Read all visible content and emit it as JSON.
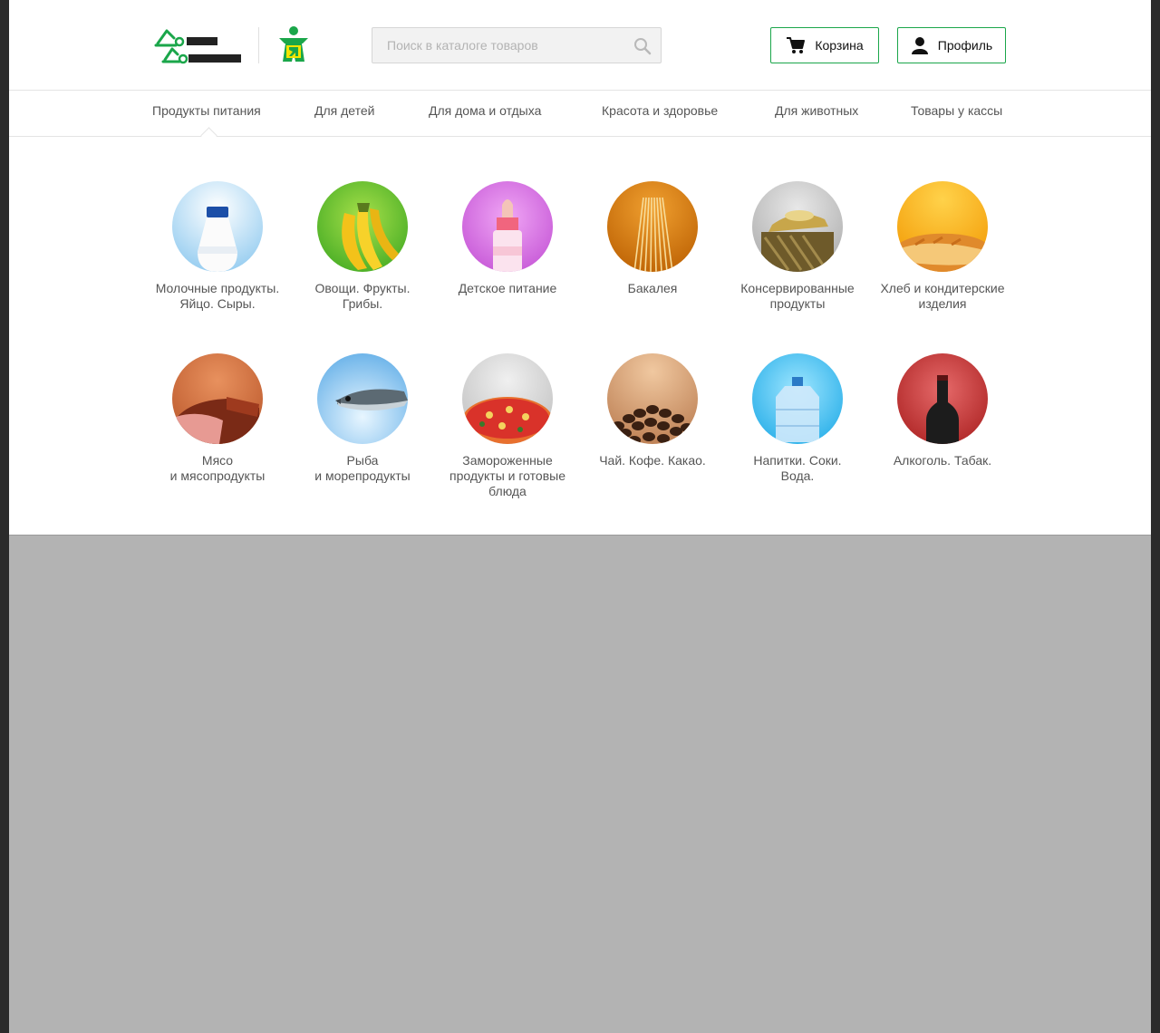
{
  "search": {
    "placeholder": "Поиск в каталоге товаров"
  },
  "header": {
    "cart_label": "Корзина",
    "profile_label": "Профиль"
  },
  "nav": {
    "items": [
      {
        "label": "Продукты питания"
      },
      {
        "label": "Для детей"
      },
      {
        "label": "Для дома и отдыха"
      },
      {
        "label": "Красота и здоровье"
      },
      {
        "label": "Для животных"
      },
      {
        "label": "Товары у кассы"
      }
    ],
    "active": "Продукты питания"
  },
  "categories": [
    {
      "label": "Молочные продукты.\nЯйцо. Сыры.",
      "icon": "milk-icon",
      "color": "#8ec9ef"
    },
    {
      "label": "Овощи. Фрукты.\nГрибы.",
      "icon": "banana-icon",
      "color": "#4fbf2a"
    },
    {
      "label": "Детское питание",
      "icon": "baby-bottle-icon",
      "color": "#c85ad8"
    },
    {
      "label": "Бакалея",
      "icon": "pasta-icon",
      "color": "#d67800"
    },
    {
      "label": "Консервированные\nпродукты",
      "icon": "canned-fish-icon",
      "color": "#b5b5b5"
    },
    {
      "label": "Хлеб и кондитерские\nизделия",
      "icon": "bread-icon",
      "color": "#f5a300"
    },
    {
      "label": "Мясо\nи мясопродукты",
      "icon": "meat-icon",
      "color": "#d46a3a"
    },
    {
      "label": "Рыба\nи морепродукты",
      "icon": "fish-icon",
      "color": "#6cb4e8"
    },
    {
      "label": "Замороженные\nпродукты и готовые\nблюда",
      "icon": "pizza-icon",
      "color": "#c8c8c8"
    },
    {
      "label": "Чай. Кофе. Какао.",
      "icon": "coffee-icon",
      "color": "#c98a5c"
    },
    {
      "label": "Напитки. Соки.\nВода.",
      "icon": "water-bottle-icon",
      "color": "#2fb8ec"
    },
    {
      "label": "Алкоголь. Табак.",
      "icon": "wine-icon",
      "color": "#c83333"
    }
  ]
}
